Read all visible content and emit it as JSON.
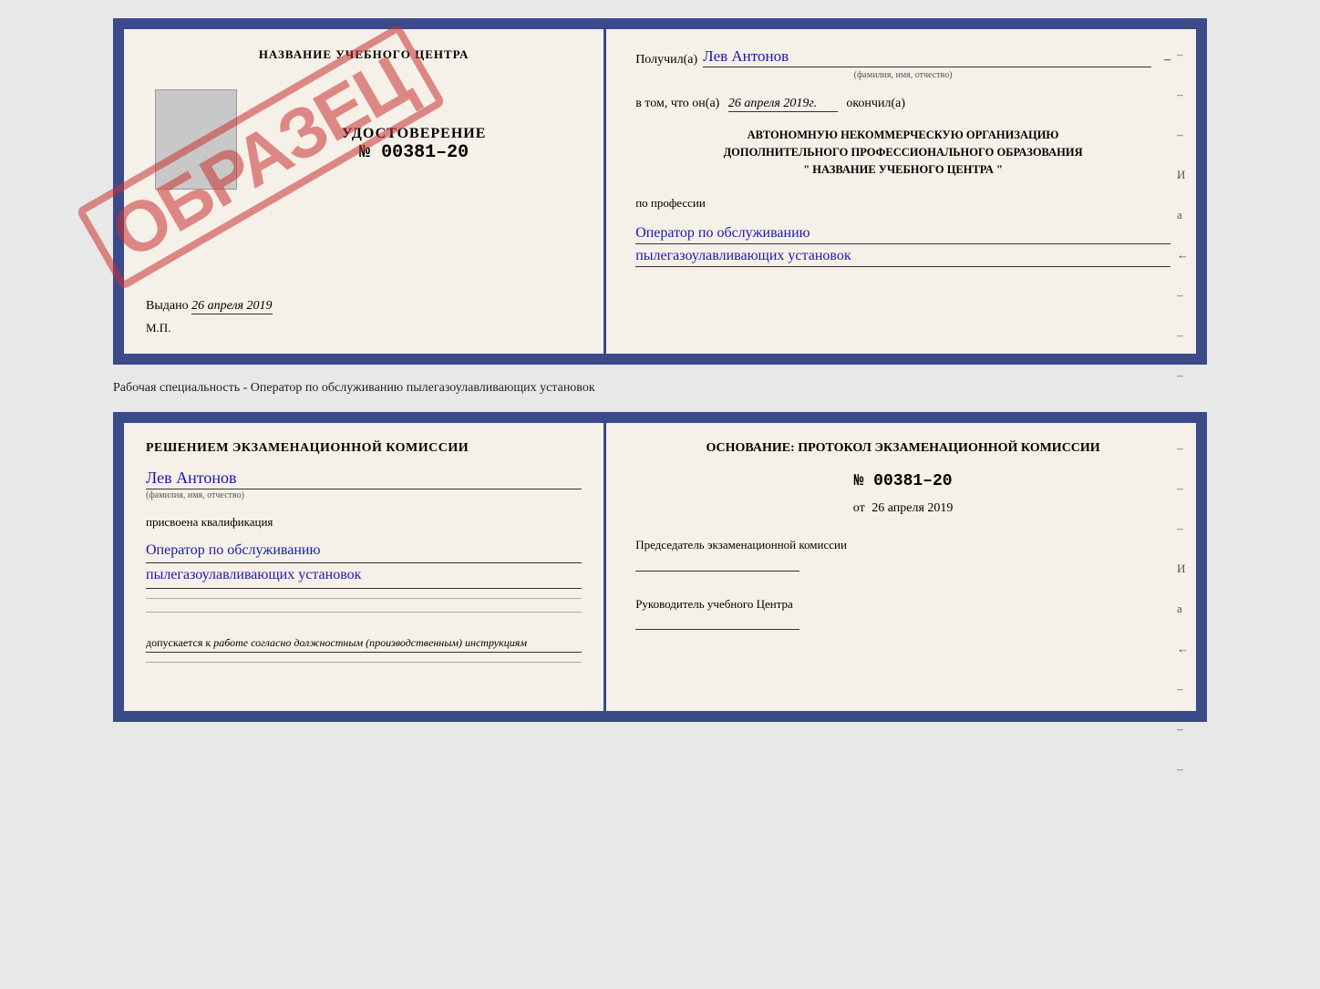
{
  "top_certificate": {
    "left": {
      "school_name": "НАЗВАНИЕ УЧЕБНОГО ЦЕНТРА",
      "stamp_text": "ОБРАЗЕЦ",
      "udostoverenie_title": "УДОСТОВЕРЕНИЕ",
      "udostoverenie_number": "№ 00381–20",
      "vydano_label": "Выдано",
      "vydano_date": "26 апреля 2019",
      "mp_label": "М.П."
    },
    "right": {
      "poluchil_label": "Получил(а)",
      "poluchil_name": "Лев Антонов",
      "fio_sub": "(фамилия, имя, отчество)",
      "vtom_prefix": "в том, что он(а)",
      "vtom_date": "26 апреля 2019г.",
      "okончил_label": "окончил(а)",
      "org_line1": "АВТОНОМНУЮ НЕКОММЕРЧЕСКУЮ ОРГАНИЗАЦИЮ",
      "org_line2": "ДОПОЛНИТЕЛЬНОГО ПРОФЕССИОНАЛЬНОГО ОБРАЗОВАНИЯ",
      "org_line3": "\" НАЗВАНИЕ УЧЕБНОГО ЦЕНТРА \"",
      "po_professii_label": "по профессии",
      "professiya_line1": "Оператор по обслуживанию",
      "professiya_line2": "пылегазоулавливающих установок"
    }
  },
  "middle_caption": "Рабочая специальность - Оператор по обслуживанию пылегазоулавливающих установок",
  "bottom_certificate": {
    "left": {
      "resheniem_label": "Решением экзаменационной комиссии",
      "fio": "Лев Антонов",
      "fio_sub": "(фамилия, имя, отчество)",
      "prisvoena_label": "присвоена квалификация",
      "qual_line1": "Оператор по обслуживанию",
      "qual_line2": "пылегазоулавливающих установок",
      "dopuskaetsya_prefix": "допускается к",
      "dopuskaetsya_italic": "работе согласно должностным (производственным) инструкциям"
    },
    "right": {
      "osnovanie_label": "Основание: протокол экзаменационной комиссии",
      "number": "№ 00381–20",
      "ot_prefix": "от",
      "ot_date": "26 апреля 2019",
      "predsedatel_label": "Председатель экзаменационной комиссии",
      "rukovoditel_label": "Руководитель учебного Центра"
    }
  },
  "dashes": [
    "–",
    "–",
    "–",
    "И",
    "а",
    "←",
    "–",
    "–",
    "–"
  ]
}
